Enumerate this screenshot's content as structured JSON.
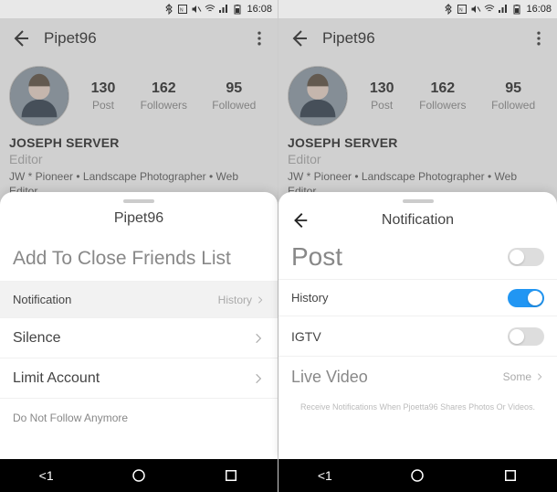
{
  "status": {
    "time": "16:08"
  },
  "profile": {
    "username": "Pipet96",
    "display_name": "JOSEPH SERVER",
    "role": "Editor",
    "bio": "JW * Pioneer • Landscape Photographer • Web Editor",
    "stats": {
      "posts_num": "130",
      "posts_lbl": "Post",
      "followers_num": "162",
      "followers_lbl": "Followers",
      "following_num": "95",
      "following_lbl": "Followed"
    }
  },
  "left_sheet": {
    "title": "Pipet96",
    "items": {
      "close_friends": "Add To Close Friends List",
      "notification": "Notification",
      "notification_sub": "History",
      "silence": "Silence",
      "limit": "Limit Account",
      "unfollow": "Do Not Follow Anymore"
    }
  },
  "right_sheet": {
    "title": "Notification",
    "items": {
      "post": "Post",
      "history": "History",
      "igtv": "IGTV",
      "live": "Live Video",
      "live_sub": "Some"
    },
    "footer": "Receive Notifications When Pjoetta96 Shares Photos Or Videos."
  },
  "nav": {
    "back": "<1"
  }
}
